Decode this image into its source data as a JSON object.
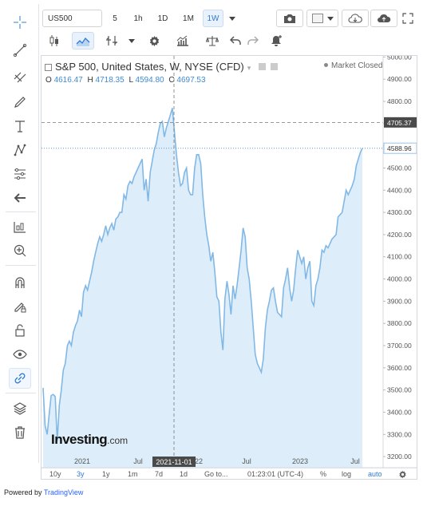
{
  "toolbar": {
    "symbol": "US500",
    "intervals": [
      "5",
      "1h",
      "1D",
      "1M",
      "1W"
    ],
    "active_interval": "1W"
  },
  "legend": {
    "title": "S&P 500, United States, W, NYSE (CFD)",
    "open_label": "O",
    "open": "4616.47",
    "high_label": "H",
    "high": "4718.35",
    "low_label": "L",
    "low": "4594.80",
    "close_label": "C",
    "close": "4697.53",
    "market_status": "Market Closed"
  },
  "crosshair": {
    "date_label": "2021-11-01",
    "price_label": "4705.37"
  },
  "last_price_label": "4588.96",
  "watermark": "Investing",
  "watermark_suffix": ".com",
  "bottom_bar": {
    "ranges": [
      "10y",
      "3y",
      "1y",
      "1m",
      "7d",
      "1d"
    ],
    "active_range": "3y",
    "goto": "Go to...",
    "time": "01:23:01 (UTC-4)",
    "percent": "%",
    "log": "log",
    "auto": "auto"
  },
  "powered_by": {
    "prefix": "Powered by ",
    "brand": "TradingView"
  },
  "colors": {
    "accent": "#2e7bd2",
    "line": "#82b8e6",
    "area": "#ddeefa",
    "label_bg": "#4a4a4a"
  },
  "chart_data": {
    "type": "area",
    "title": "S&P 500, United States, W, NYSE (CFD)",
    "xlabel": "",
    "ylabel": "",
    "x_tick_labels": [
      "2021",
      "Jul",
      "2021-11-01",
      "2022",
      "Jul",
      "2023",
      "Jul"
    ],
    "y_tick_labels": [
      "3200.00",
      "3300.00",
      "3400.00",
      "3500.00",
      "3600.00",
      "3700.00",
      "3800.00",
      "3900.00",
      "4000.00",
      "4100.00",
      "4200.00",
      "4300.00",
      "4400.00",
      "4500.00",
      "4600.00",
      "4700.00",
      "4800.00",
      "4900.00",
      "5000.00"
    ],
    "ylim": [
      3150,
      5005
    ],
    "grid": false,
    "series": [
      {
        "values": [
          3510,
          3340,
          3300,
          3390,
          3475,
          3480,
          3470,
          3270,
          3430,
          3500,
          3590,
          3620,
          3700,
          3720,
          3700,
          3760,
          3790,
          3810,
          3860,
          3830,
          3940,
          3970,
          3950,
          3990,
          4030,
          4080,
          4120,
          4160,
          4190,
          4170,
          4200,
          4240,
          4200,
          4230,
          4250,
          4220,
          4270,
          4280,
          4300,
          4300,
          4380,
          4360,
          4420,
          4440,
          4430,
          4460,
          4480,
          4500,
          4520,
          4540,
          4400,
          4450,
          4350,
          4480,
          4530,
          4580,
          4610,
          4660,
          4700,
          4710,
          4640,
          4680,
          4710,
          4740,
          4770,
          4660,
          4560,
          4480,
          4420,
          4430,
          4480,
          4500,
          4400,
          4380,
          4380,
          4500,
          4560,
          4560,
          4520,
          4380,
          4280,
          4200,
          4150,
          4080,
          4120,
          4030,
          3920,
          3900,
          3760,
          3680,
          3910,
          3990,
          3930,
          3840,
          3970,
          3910,
          3970,
          4050,
          4130,
          4230,
          4190,
          4050,
          4000,
          3900,
          3780,
          3660,
          3620,
          3600,
          3580,
          3640,
          3780,
          3860,
          3900,
          3950,
          3960,
          3900,
          3850,
          3840,
          3830,
          3960,
          4000,
          4050,
          3960,
          3900,
          3950,
          4050,
          4130,
          4100,
          4070,
          4100,
          4000,
          4050,
          4080,
          3900,
          3880,
          3970,
          4000,
          4050,
          4130,
          4120,
          4150,
          4140,
          4160,
          4180,
          4190,
          4200,
          4280,
          4290,
          4300,
          4350,
          4400,
          4380,
          4400,
          4420,
          4450,
          4510,
          4540,
          4570,
          4589
        ]
      }
    ]
  }
}
